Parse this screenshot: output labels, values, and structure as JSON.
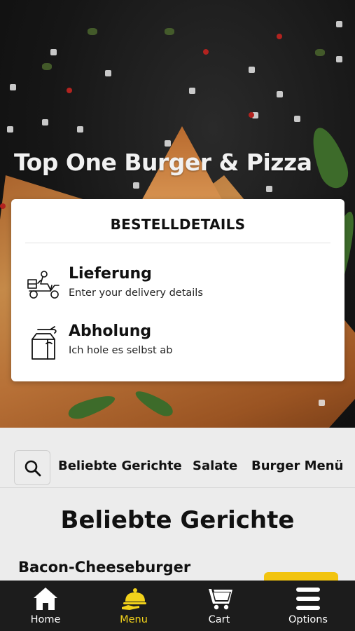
{
  "hero": {
    "title": "Top One Burger & Pizza"
  },
  "order_card": {
    "title": "BESTELLDETAILS",
    "options": [
      {
        "name": "Lieferung",
        "description": "Enter your delivery details",
        "icon": "delivery-scooter-icon"
      },
      {
        "name": "Abholung",
        "description": "Ich hole es selbst ab",
        "icon": "takeaway-bag-icon"
      }
    ]
  },
  "categories": {
    "search_icon": "search-icon",
    "items": [
      "Beliebte Gerichte",
      "Salate",
      "Burger Menü"
    ]
  },
  "main": {
    "section_title": "Beliebte Gerichte",
    "items": [
      {
        "name": "Bacon-Cheeseburger"
      }
    ]
  },
  "bottom_nav": {
    "items": [
      {
        "label": "Home",
        "icon": "home-icon",
        "active": false
      },
      {
        "label": "Menu",
        "icon": "serving-cloche-icon",
        "active": true
      },
      {
        "label": "Cart",
        "icon": "cart-icon",
        "active": false
      },
      {
        "label": "Options",
        "icon": "hamburger-menu-icon",
        "active": false
      }
    ]
  },
  "colors": {
    "accent": "#f2c40f",
    "nav_bg": "#1c1c1c",
    "active_nav": "#f2d21b"
  }
}
